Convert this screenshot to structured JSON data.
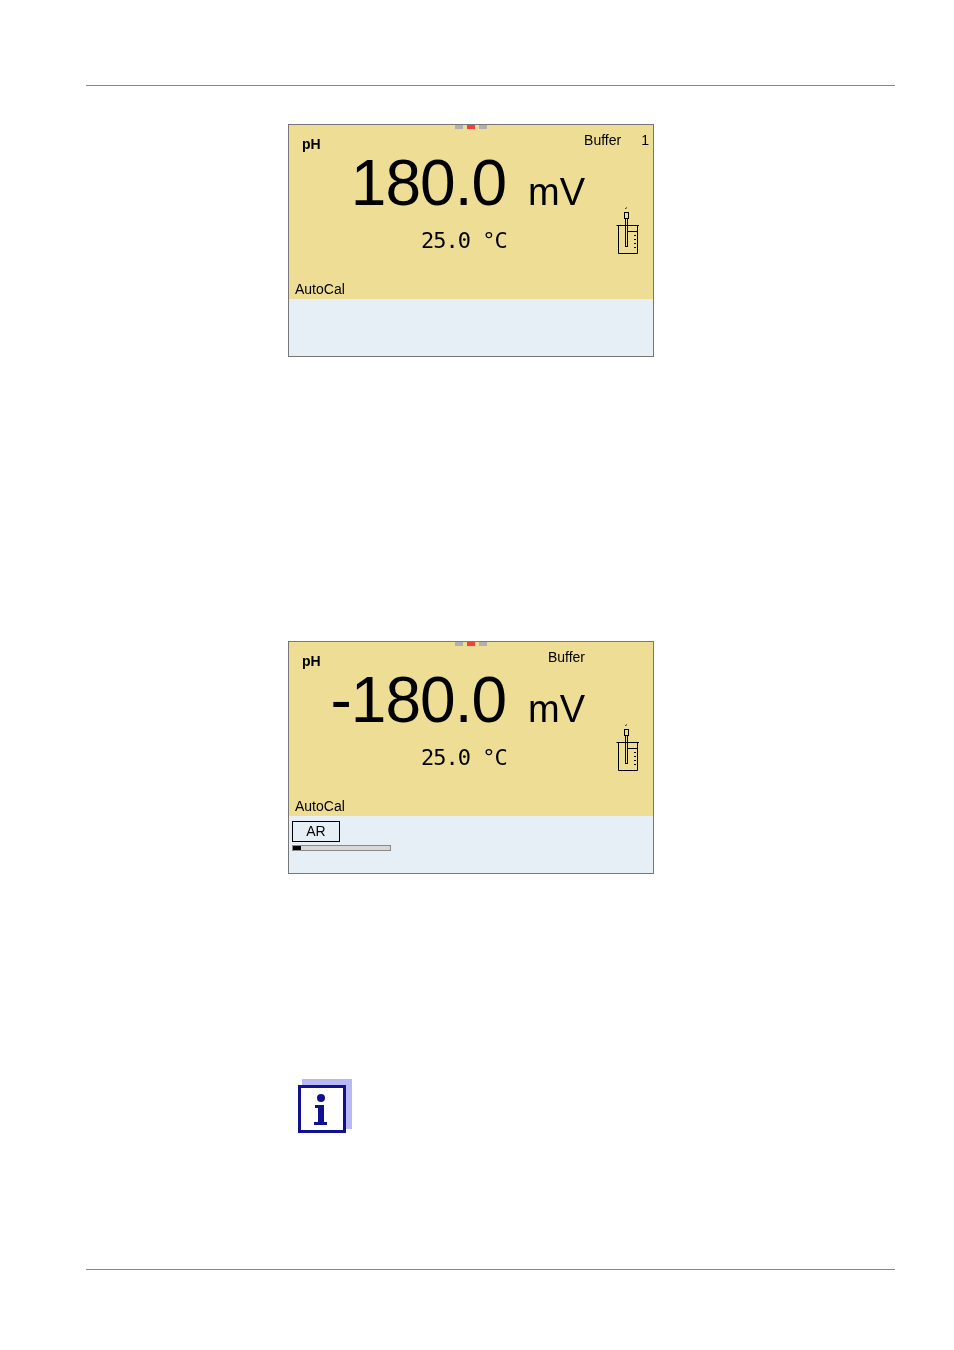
{
  "screens": [
    {
      "mode": "pH",
      "page_dots": [
        {
          "selected": false
        },
        {
          "selected": true
        },
        {
          "selected": false
        }
      ],
      "status": "Buffer",
      "buffer_number": "1",
      "value": "180.0",
      "unit": "mV",
      "temperature": "25.0 °C",
      "function": "AutoCal"
    },
    {
      "mode": "pH",
      "page_dots": [
        {
          "selected": false
        },
        {
          "selected": true
        },
        {
          "selected": false
        }
      ],
      "status": "Buffer",
      "value": "-180.0",
      "unit": "mV",
      "temperature": "25.0 °C",
      "function": "AutoCal",
      "indicator": {
        "label": "AR",
        "level": 0.08
      }
    }
  ]
}
